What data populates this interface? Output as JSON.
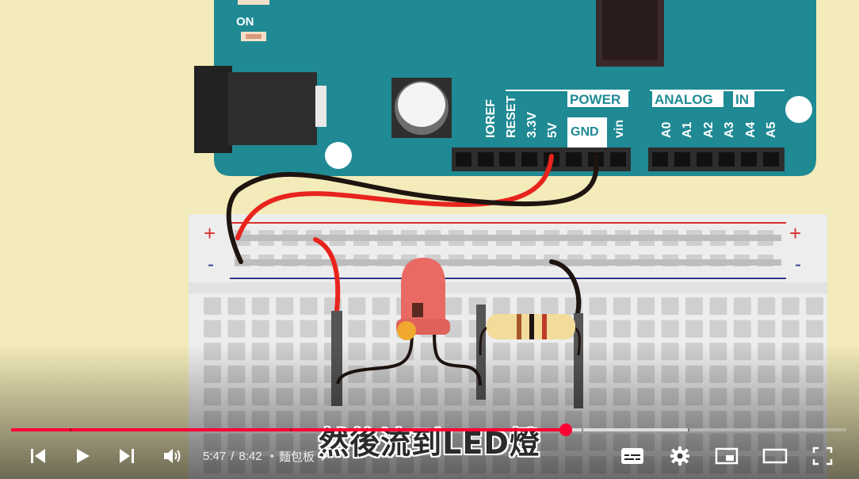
{
  "scene": {
    "board_labels": {
      "on": "ON",
      "ioref": "IOREF",
      "reset": "RESET",
      "v33": "3.3V",
      "v5": "5V",
      "gnd": "GND",
      "vin": "vin",
      "power": "POWER",
      "analog": "ANALOG",
      "in": "IN",
      "a0": "A0",
      "a1": "A1",
      "a2": "A2",
      "a3": "A3",
      "a4": "A4",
      "a5": "A5"
    },
    "rail_plus": "+",
    "rail_minus": "-",
    "colors": {
      "background": "#f3ebb9",
      "board": "#1f8a94",
      "red_wire": "#e8241d",
      "black_wire": "#1e1410",
      "led": "#e86a63",
      "progress": "#ff0033"
    }
  },
  "caption": "然後流到LED燈",
  "player": {
    "current_time": "5:47",
    "separator": "/",
    "duration": "8:42",
    "chapter": "麵包板",
    "progress_played": 0.664,
    "progress_buffered": 0.81,
    "icons": {
      "previous": "previous-icon",
      "play": "play-icon",
      "next": "next-icon",
      "volume": "volume-icon",
      "subtitles": "subtitles-icon",
      "settings": "gear-icon",
      "miniplayer": "miniplayer-icon",
      "theater": "theater-icon",
      "fullscreen": "fullscreen-icon"
    }
  }
}
